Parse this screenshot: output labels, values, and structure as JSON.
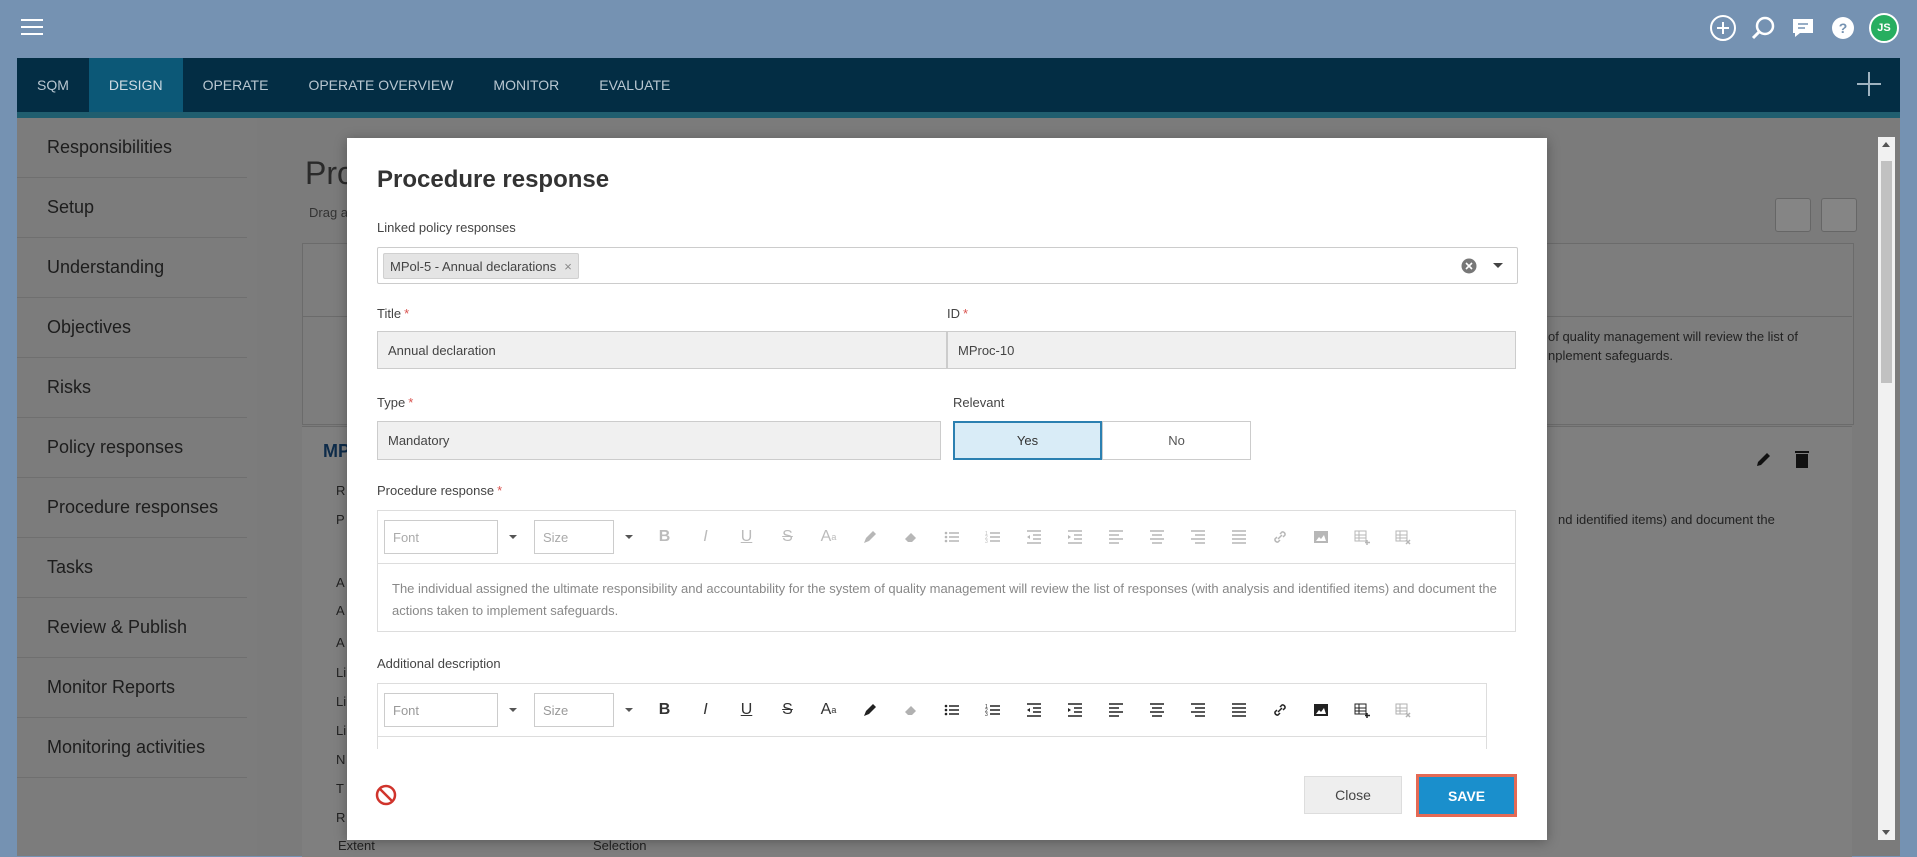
{
  "nav": {
    "tabs": [
      "SQM",
      "DESIGN",
      "OPERATE",
      "OPERATE OVERVIEW",
      "MONITOR",
      "EVALUATE"
    ],
    "active_tab": "DESIGN"
  },
  "topbar": {
    "avatar_initials": "JS",
    "icons": [
      "add-circle-icon",
      "search-icon",
      "chat-icon",
      "help-icon"
    ]
  },
  "sidebar": {
    "items": [
      "Responsibilities",
      "Setup",
      "Understanding",
      "Objectives",
      "Risks",
      "Policy responses",
      "Procedure responses",
      "Tasks",
      "Review & Publish",
      "Monitor Reports",
      "Monitoring activities"
    ]
  },
  "background": {
    "title": "Pro",
    "subtitle": "Drag a",
    "right_text": "of quality management will review the list of nplement safeguards.",
    "right_text2": "nd identified items) and document the",
    "card_title": "MP",
    "row_letters": [
      "R",
      "P",
      "A",
      "A",
      "A",
      "Li",
      "Li",
      "Li",
      "N",
      "T",
      "R"
    ],
    "extent_label": "Extent",
    "extent_value": "Selection"
  },
  "modal": {
    "title": "Procedure response",
    "linked_label": "Linked policy responses",
    "linked_tag": "MPol-5 - Annual declarations",
    "tag_remove": "×",
    "title_label": "Title",
    "title_value": "Annual declaration",
    "id_label": "ID",
    "id_value": "MProc-10",
    "type_label": "Type",
    "type_value": "Mandatory",
    "relevant_label": "Relevant",
    "relevant_yes": "Yes",
    "relevant_no": "No",
    "relevant_selected": "Yes",
    "procedure_label": "Procedure response",
    "required_mark": "*",
    "procedure_text": "The individual assigned the ultimate responsibility and accountability for the system of quality management will review the list of responses (with analysis and identified items) and document the actions taken to implement safeguards.",
    "additional_label": "Additional description",
    "font_placeholder": "Font",
    "size_placeholder": "Size",
    "close_label": "Close",
    "save_label": "SAVE"
  },
  "colors": {
    "nav_bg": "#032d44",
    "nav_active": "#0c5877",
    "save": "#1a8fcc",
    "save_outline": "#e46a55",
    "required": "#d9534f"
  }
}
